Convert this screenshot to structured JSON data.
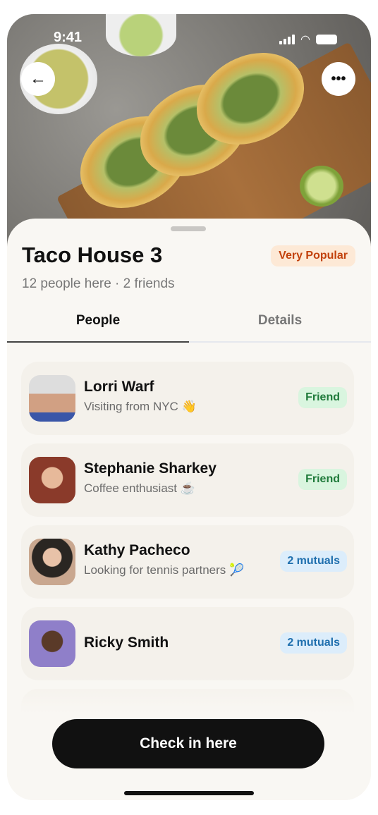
{
  "status": {
    "time": "9:41"
  },
  "header": {
    "back_icon": "arrow-left-icon",
    "more_icon": "ellipsis-icon"
  },
  "venue": {
    "title": "Taco House 3",
    "popularity": "Very Popular",
    "subtitle": "12 people here · 2 friends"
  },
  "tabs": [
    {
      "label": "People",
      "active": true
    },
    {
      "label": "Details",
      "active": false
    }
  ],
  "people": [
    {
      "name": "Lorri Warf",
      "status": "Visiting from NYC 👋",
      "badge": "Friend",
      "badge_type": "friend",
      "avatar_color": "#c9a48a"
    },
    {
      "name": "Stephanie Sharkey",
      "status": "Coffee enthusiast ☕",
      "badge": "Friend",
      "badge_type": "friend",
      "avatar_color": "#8a3a2a"
    },
    {
      "name": "Kathy Pacheco",
      "status": "Looking for tennis partners 🎾",
      "badge": "2 mutuals",
      "badge_type": "mutual",
      "avatar_color": "#3a3430"
    },
    {
      "name": "Ricky Smith",
      "status": "",
      "badge": "2 mutuals",
      "badge_type": "mutual",
      "avatar_color": "#8f7fc9"
    }
  ],
  "cta": {
    "label": "Check in here"
  }
}
